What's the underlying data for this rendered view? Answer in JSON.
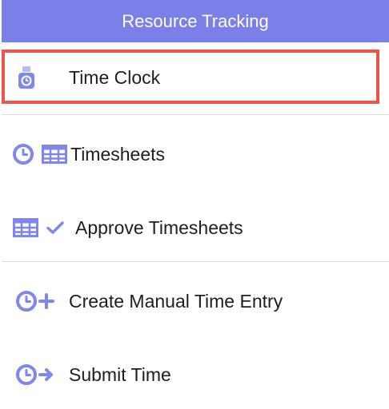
{
  "header": {
    "title": "Resource Tracking"
  },
  "items": [
    {
      "label": "Time Clock",
      "icons": [
        "time-clock-icon"
      ],
      "highlighted": true
    },
    {
      "label": "Timesheets",
      "icons": [
        "clock-icon",
        "grid-icon"
      ]
    },
    {
      "label": "Approve Timesheets",
      "icons": [
        "grid-icon",
        "checkmark-icon"
      ]
    },
    {
      "label": "Create Manual Time Entry",
      "icons": [
        "clock-icon",
        "plus-icon"
      ]
    },
    {
      "label": "Submit Time",
      "icons": [
        "clock-icon",
        "arrow-right-icon"
      ]
    }
  ],
  "colors": {
    "header_bg": "#7a80e8",
    "icon": "#7f86ee",
    "highlight_border": "#ee5448",
    "text": "#1e1e1e"
  }
}
